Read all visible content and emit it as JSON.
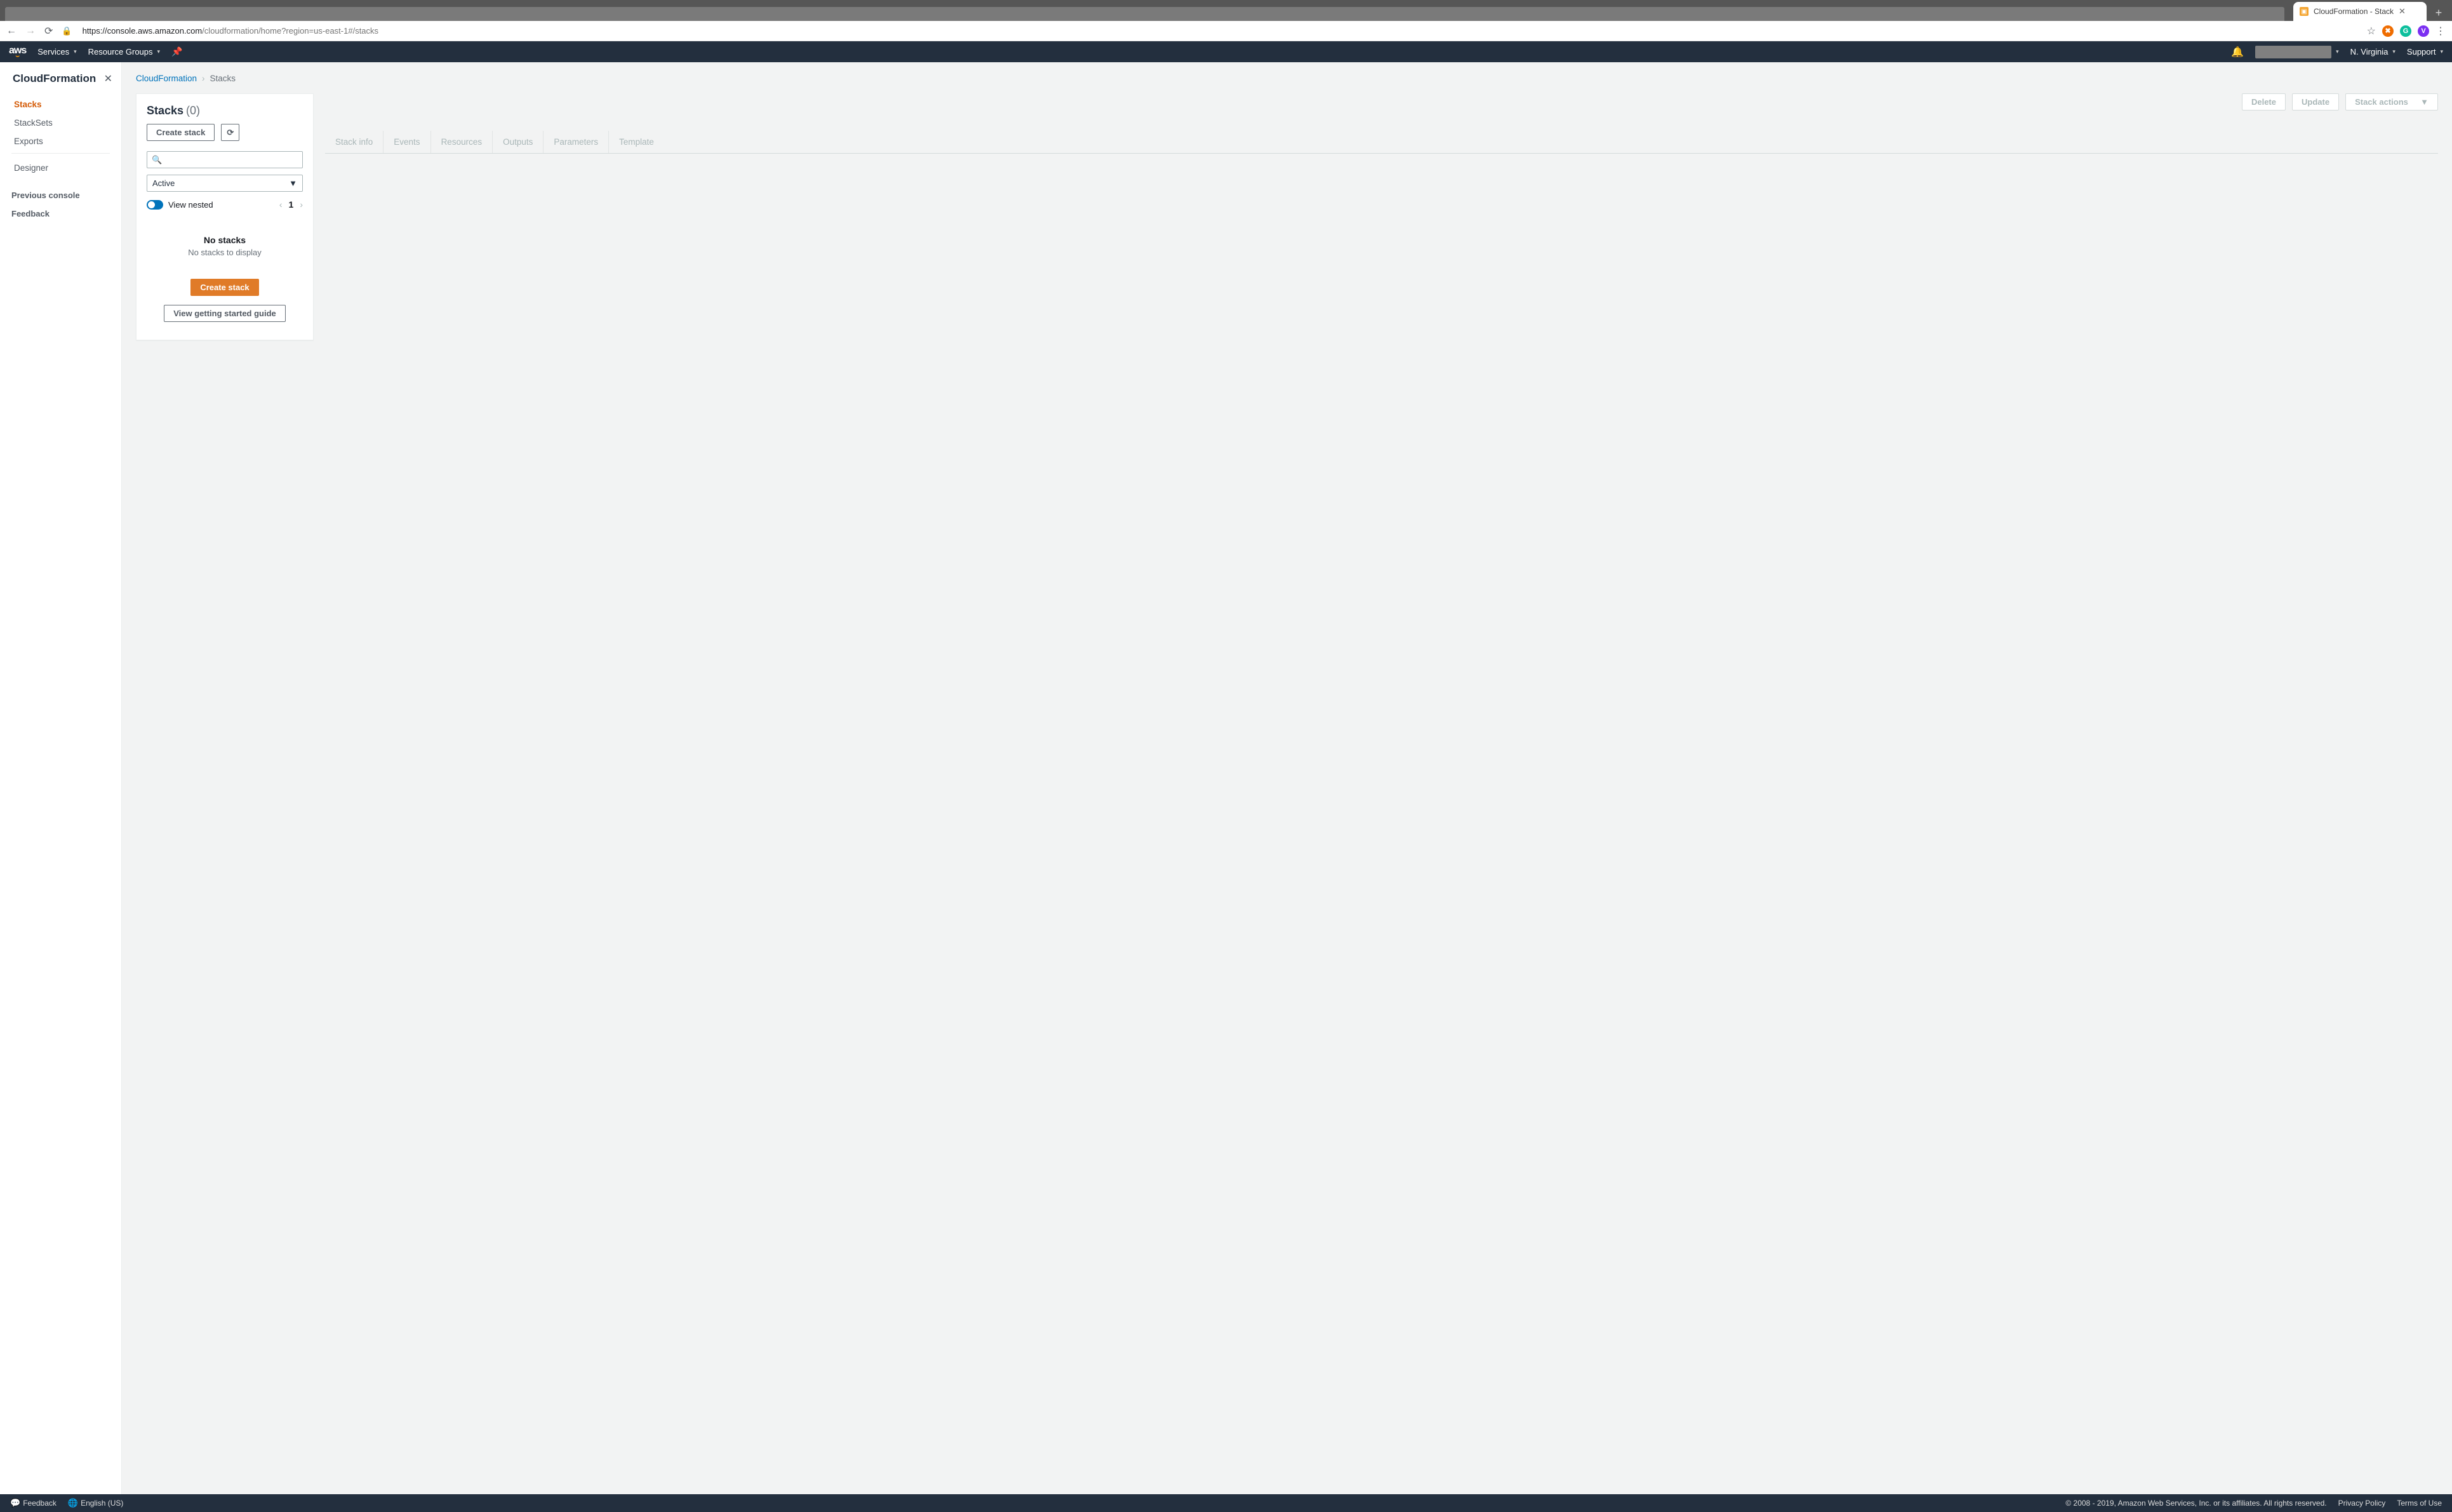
{
  "browser": {
    "tab_title": "CloudFormation - Stack",
    "url_domain": "https://console.aws.amazon.com",
    "url_path": "/cloudformation/home?region=us-east-1#/stacks",
    "avatar_letter": "V"
  },
  "awsnav": {
    "services": "Services",
    "resource_groups": "Resource Groups",
    "region": "N. Virginia",
    "support": "Support"
  },
  "sidebar": {
    "title": "CloudFormation",
    "items": [
      "Stacks",
      "StackSets",
      "Exports"
    ],
    "designer": "Designer",
    "previous": "Previous console",
    "feedback": "Feedback"
  },
  "breadcrumb": {
    "root": "CloudFormation",
    "current": "Stacks"
  },
  "panel": {
    "title": "Stacks",
    "count": "(0)",
    "create": "Create stack",
    "filter_value": "Active",
    "view_nested": "View nested",
    "page_num": "1",
    "empty_title": "No stacks",
    "empty_sub": "No stacks to display",
    "empty_create": "Create stack",
    "empty_guide": "View getting started guide"
  },
  "detail": {
    "delete": "Delete",
    "update": "Update",
    "stack_actions": "Stack actions",
    "tabs": [
      "Stack info",
      "Events",
      "Resources",
      "Outputs",
      "Parameters",
      "Template"
    ]
  },
  "footer": {
    "feedback": "Feedback",
    "language": "English (US)",
    "copyright": "© 2008 - 2019, Amazon Web Services, Inc. or its affiliates. All rights reserved.",
    "privacy": "Privacy Policy",
    "terms": "Terms of Use"
  }
}
